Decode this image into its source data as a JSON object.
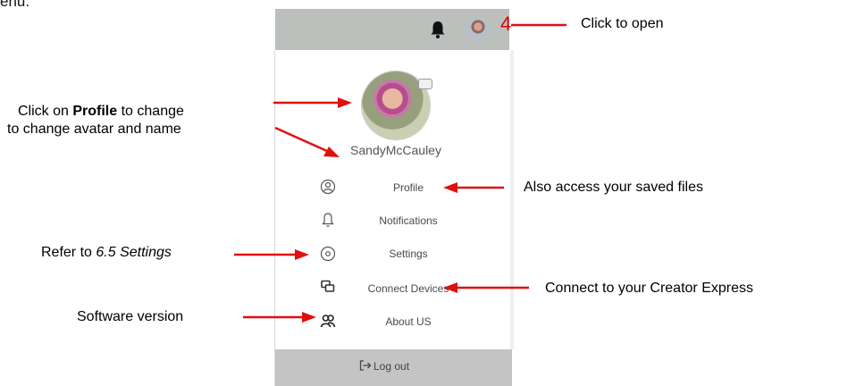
{
  "caption_fragment": "enu.",
  "step_number": "4",
  "menu": {
    "username": "SandyMcCauley",
    "items": [
      {
        "label": "Profile",
        "icon": "user-circle-icon"
      },
      {
        "label": "Notifications",
        "icon": "bell-outline-icon"
      },
      {
        "label": "Settings",
        "icon": "settings-circle-icon"
      },
      {
        "label": "Connect Devices",
        "icon": "connect-devices-icon"
      },
      {
        "label": "About US",
        "icon": "users-icon"
      }
    ],
    "logout_label": "Log out"
  },
  "annotations": {
    "click_to_open": "Click to open",
    "profile_line1_prefix": "Click on",
    "profile_line1_bold": "Profile",
    "profile_line1_suffix": "to change",
    "profile_line2": "to change avatar and  name",
    "saved_files": "Also access your saved files",
    "settings_prefix": "Refer to",
    "settings_ref": "6.5 Settings",
    "connect": "Connect to your Creator Express",
    "software_version": "Software version"
  },
  "colors": {
    "annotation_arrow": "#e01010",
    "topbar": "#bcc0bd",
    "logout_bar": "#c4c4c4"
  }
}
